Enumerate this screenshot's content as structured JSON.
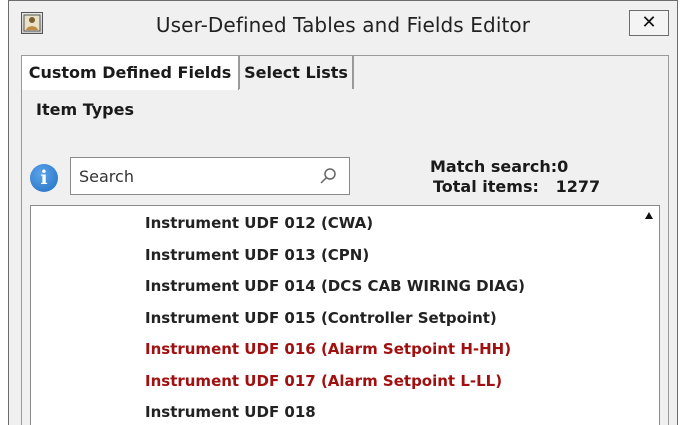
{
  "window": {
    "title": "User-Defined Tables and Fields Editor",
    "close_label": "✕",
    "app_icon": "app-icon"
  },
  "tabs": [
    {
      "label": "Custom Defined Fields",
      "active": true
    },
    {
      "label": "Select Lists",
      "active": false
    }
  ],
  "panel": {
    "section_label": "Item Types",
    "info_icon": "info-icon",
    "search": {
      "placeholder": "Search",
      "value": ""
    },
    "match_search": "Match search:0",
    "total_items": "Total items:   1277"
  },
  "list": {
    "items": [
      {
        "label": "Instrument UDF 012 (CWA)",
        "highlight": false
      },
      {
        "label": "Instrument UDF 013 (CPN)",
        "highlight": false
      },
      {
        "label": "Instrument UDF 014 (DCS CAB WIRING DIAG)",
        "highlight": false
      },
      {
        "label": "Instrument UDF 015 (Controller Setpoint)",
        "highlight": false
      },
      {
        "label": "Instrument UDF 016 (Alarm Setpoint H-HH)",
        "highlight": true
      },
      {
        "label": "Instrument UDF 017 (Alarm Setpoint L-LL)",
        "highlight": true
      },
      {
        "label": "Instrument UDF 018",
        "highlight": false
      }
    ]
  },
  "colors": {
    "highlight_text": "#a01010",
    "info_blue": "#1f6fc4"
  }
}
